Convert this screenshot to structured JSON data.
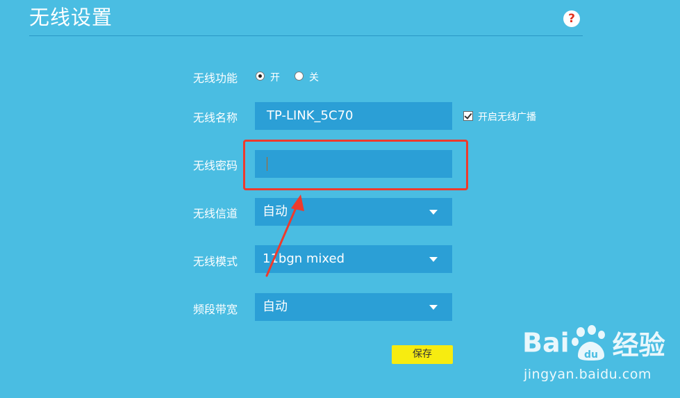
{
  "page": {
    "title": "无线设置",
    "help_icon": "help-icon"
  },
  "form": {
    "wireless_function": {
      "label": "无线功能",
      "options": [
        {
          "label": "开",
          "checked": true
        },
        {
          "label": "关",
          "checked": false
        }
      ]
    },
    "wireless_name": {
      "label": "无线名称",
      "value": "TP-LINK_5C70",
      "broadcast_checkbox": {
        "label": "开启无线广播",
        "checked": true
      }
    },
    "wireless_password": {
      "label": "无线密码",
      "value": ""
    },
    "wireless_channel": {
      "label": "无线信道",
      "selected": "自动"
    },
    "wireless_mode": {
      "label": "无线模式",
      "selected": "11bgn mixed"
    },
    "bandwidth": {
      "label": "频段带宽",
      "selected": "自动"
    },
    "save_label": "保存"
  },
  "colors": {
    "background": "#4abde2",
    "field": "#2b9fd6",
    "save_button": "#f7ec10",
    "annotation": "#ee3a2c"
  },
  "watermark": {
    "logo_text_left": "Bai",
    "logo_text_right": "经验",
    "logo_du": "du",
    "url": "jingyan.baidu.com"
  }
}
